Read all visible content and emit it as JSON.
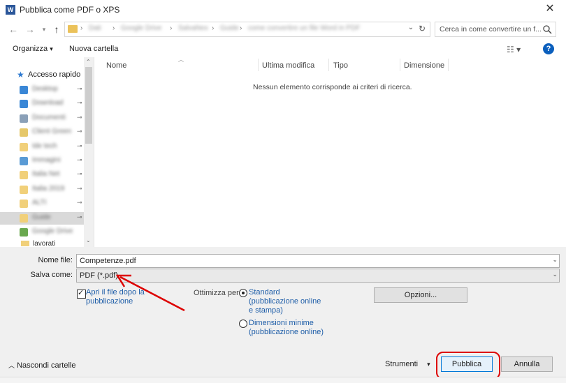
{
  "window": {
    "title": "Pubblica come PDF o XPS",
    "app_icon_letter": "W",
    "close_label": "✕"
  },
  "navigation": {
    "back_icon": "←",
    "forward_icon": "→",
    "history_icon": "▾",
    "up_icon": "↑",
    "breadcrumb": [
      "Dati",
      "Google Drive",
      "SalvaNex",
      "Guide",
      "come convertire un file Word in PDF"
    ],
    "refresh_icon": "↻",
    "dropdown_icon": "⌄"
  },
  "search": {
    "placeholder": "Cerca in come convertire un f..."
  },
  "toolbar": {
    "organize_label": "Organizza",
    "organize_arrow": "▾",
    "new_folder_label": "Nuova cartella",
    "view_icon": "☷ ▾",
    "help_label": "?"
  },
  "sidebar": {
    "quick_access_label": "Accesso rapido",
    "items": [
      {
        "label": "Desktop",
        "color": "#3a87d6"
      },
      {
        "label": "Download",
        "color": "#3a87d6"
      },
      {
        "label": "Documenti",
        "color": "#8aa0b8"
      },
      {
        "label": "Client Green",
        "color": "#e6c86a"
      },
      {
        "label": "Ide tech",
        "color": "#f1d07a"
      },
      {
        "label": "Immagini",
        "color": "#5a9bd5"
      },
      {
        "label": "Italia Net",
        "color": "#f1d07a"
      },
      {
        "label": "Italia 2019",
        "color": "#f1d07a"
      },
      {
        "label": "ALTI",
        "color": "#f1d07a"
      },
      {
        "label": "Guide",
        "color": "#f1d07a"
      },
      {
        "label": "Google Drive",
        "color": "#6aa84f"
      }
    ],
    "pin_icon": "📌",
    "overflow_label": "lavorati"
  },
  "file_list": {
    "columns": [
      "Nome",
      "Ultima modifica",
      "Tipo",
      "Dimensione"
    ],
    "empty_message": "Nessun elemento corrisponde ai criteri di ricerca."
  },
  "form": {
    "filename_label": "Nome file:",
    "filename_value": "Competenze.pdf",
    "savetype_label": "Salva come:",
    "savetype_value": "PDF (*.pdf)",
    "open_after_label": "Apri il file dopo la pubblicazione",
    "optimize_label": "Ottimizza per:",
    "option_standard": "Standard (pubblicazione online e stampa)",
    "option_minimal": "Dimensioni minime (pubblicazione online)",
    "options_button": "Opzioni..."
  },
  "footer": {
    "hide_folders_label": "Nascondi cartelle",
    "tools_label": "Strumenti",
    "publish_label": "Pubblica",
    "cancel_label": "Annulla"
  },
  "colors": {
    "annotation": "#dd0000",
    "link": "#1f5ea8",
    "help_badge": "#0b5fbd"
  }
}
